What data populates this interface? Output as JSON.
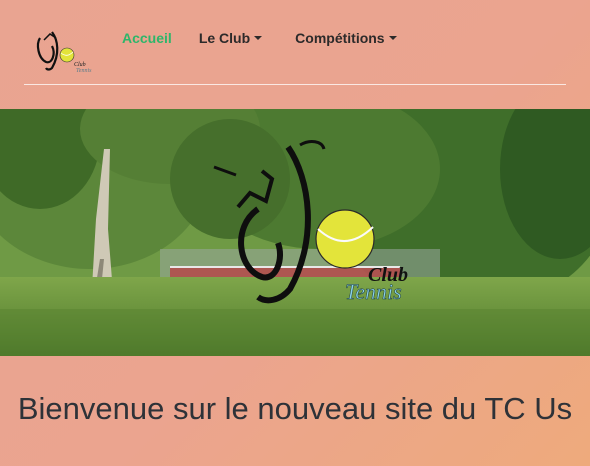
{
  "nav": {
    "logo_icon": "tc-us-logo-icon",
    "items": [
      {
        "label": "Accueil",
        "active": true
      },
      {
        "label": "Le Club",
        "dropdown": true
      },
      {
        "label": "Compétitions",
        "dropdown": true
      }
    ]
  },
  "hero": {
    "image": "tennis-courts-with-trees",
    "logo_word_club": "Club",
    "logo_word_tennis": "Tennis"
  },
  "main": {
    "heading": "Bienvenue sur le nouveau site du TC Us"
  },
  "colors": {
    "background": "#eaa48e",
    "active_link": "#2eb66a",
    "text": "#2c2a2a",
    "heading": "#2e3238",
    "ball": "#e3e43a"
  }
}
